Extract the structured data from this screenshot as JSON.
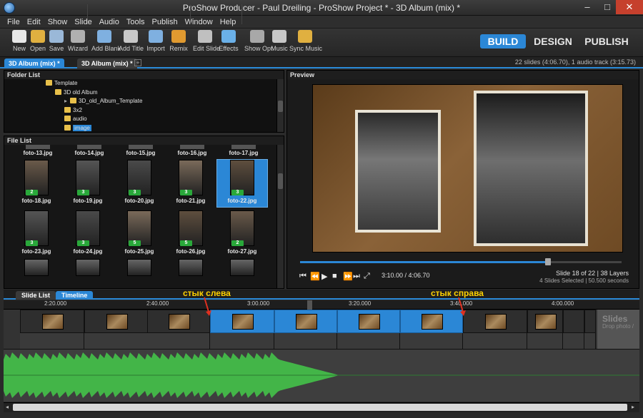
{
  "window": {
    "title": "ProShow Producer - Paul Dreiling - ProShow Project * - 3D Album (mix) *",
    "minimize": "–",
    "maximize": "□",
    "close": "✕"
  },
  "menu": [
    "File",
    "Edit",
    "Show",
    "Slide",
    "Audio",
    "Tools",
    "Publish",
    "Window",
    "Help"
  ],
  "toolbar": [
    {
      "label": "New",
      "icon": "new-icon",
      "color": "#e8e8e8"
    },
    {
      "label": "Open",
      "icon": "folder-open-icon",
      "color": "#e0b040"
    },
    {
      "label": "Save",
      "icon": "save-icon",
      "color": "#9ab8d8"
    },
    {
      "label": "Wizard",
      "icon": "wizard-icon",
      "color": "#b0b0b0"
    },
    {
      "label": "Add Blank",
      "icon": "add-blank-icon",
      "color": "#7fb0e0"
    },
    {
      "label": "Add Title",
      "icon": "add-title-icon",
      "color": "#c8c8c8"
    },
    {
      "label": "Import",
      "icon": "import-icon",
      "color": "#7fb0e0"
    },
    {
      "label": "Remix",
      "icon": "remix-icon",
      "color": "#e09a30"
    },
    {
      "label": "Edit Slide",
      "icon": "edit-slide-icon",
      "color": "#c0c0c0"
    },
    {
      "label": "Effects",
      "icon": "effects-icon",
      "color": "#6ab0e8"
    },
    {
      "label": "Show Opt",
      "icon": "show-options-icon",
      "color": "#a8a8a8"
    },
    {
      "label": "Music",
      "icon": "music-icon",
      "color": "#c8c8c8"
    },
    {
      "label": "Sync Music",
      "icon": "sync-music-icon",
      "color": "#e0b040"
    }
  ],
  "modes": {
    "build": "BUILD",
    "design": "DESIGN",
    "publish": "PUBLISH"
  },
  "project_tabs": [
    "3D Album (mix) *",
    "3D Album (mix) *"
  ],
  "project_add": "+",
  "slides_info": "22 slides (4:06.70), 1 audio track (3:15.73)",
  "folder_list": {
    "title": "Folder List",
    "items": [
      {
        "label": "Template",
        "indent": 0
      },
      {
        "label": "3D old Album",
        "indent": 1
      },
      {
        "label": "3D_old_Album_Template",
        "indent": 2,
        "expander": "▸"
      },
      {
        "label": "3x2",
        "indent": 2
      },
      {
        "label": "audio",
        "indent": 2
      },
      {
        "label": "image",
        "indent": 2,
        "selected": true
      }
    ]
  },
  "file_list": {
    "title": "File List",
    "top_row": [
      "foto-13.jpg",
      "foto-14.jpg",
      "foto-15.jpg",
      "foto-16.jpg",
      "foto-17.jpg"
    ],
    "rows": [
      [
        {
          "name": "foto-18.jpg",
          "count": "2"
        },
        {
          "name": "foto-19.jpg",
          "count": "3"
        },
        {
          "name": "foto-20.jpg",
          "count": "3"
        },
        {
          "name": "foto-21.jpg",
          "count": "3"
        },
        {
          "name": "foto-22.jpg",
          "count": "3",
          "selected": true
        }
      ],
      [
        {
          "name": "foto-23.jpg",
          "count": "3"
        },
        {
          "name": "foto-24.jpg",
          "count": "3"
        },
        {
          "name": "foto-25.jpg",
          "count": "5"
        },
        {
          "name": "foto-26.jpg",
          "count": "5"
        },
        {
          "name": "foto-27.jpg",
          "count": "2"
        }
      ]
    ]
  },
  "preview": {
    "title": "Preview",
    "time": "3:10.00 / 4:06.70",
    "slide_info": "Slide 18 of 22  |  38 Layers",
    "selection_info": "4 Slides Selected  |  50.500 seconds",
    "controls": [
      "⏮",
      "⏪",
      "▶",
      "■",
      "⏩",
      "⏭",
      "⤢"
    ],
    "progress": 0.77
  },
  "bottom_tabs": [
    "Slide List",
    "Timeline"
  ],
  "annotations": {
    "left": "стык слева",
    "right": "стык справа"
  },
  "ruler": [
    "2:20.000",
    "2:40.000",
    "3:00.000",
    "3:20.000",
    "3:40.000",
    "4:00.000"
  ],
  "timeline_drop": {
    "title": "Slides",
    "subtitle": "Drop photo /"
  },
  "scroll_arrows": {
    "left": "◂",
    "right": "▸"
  }
}
